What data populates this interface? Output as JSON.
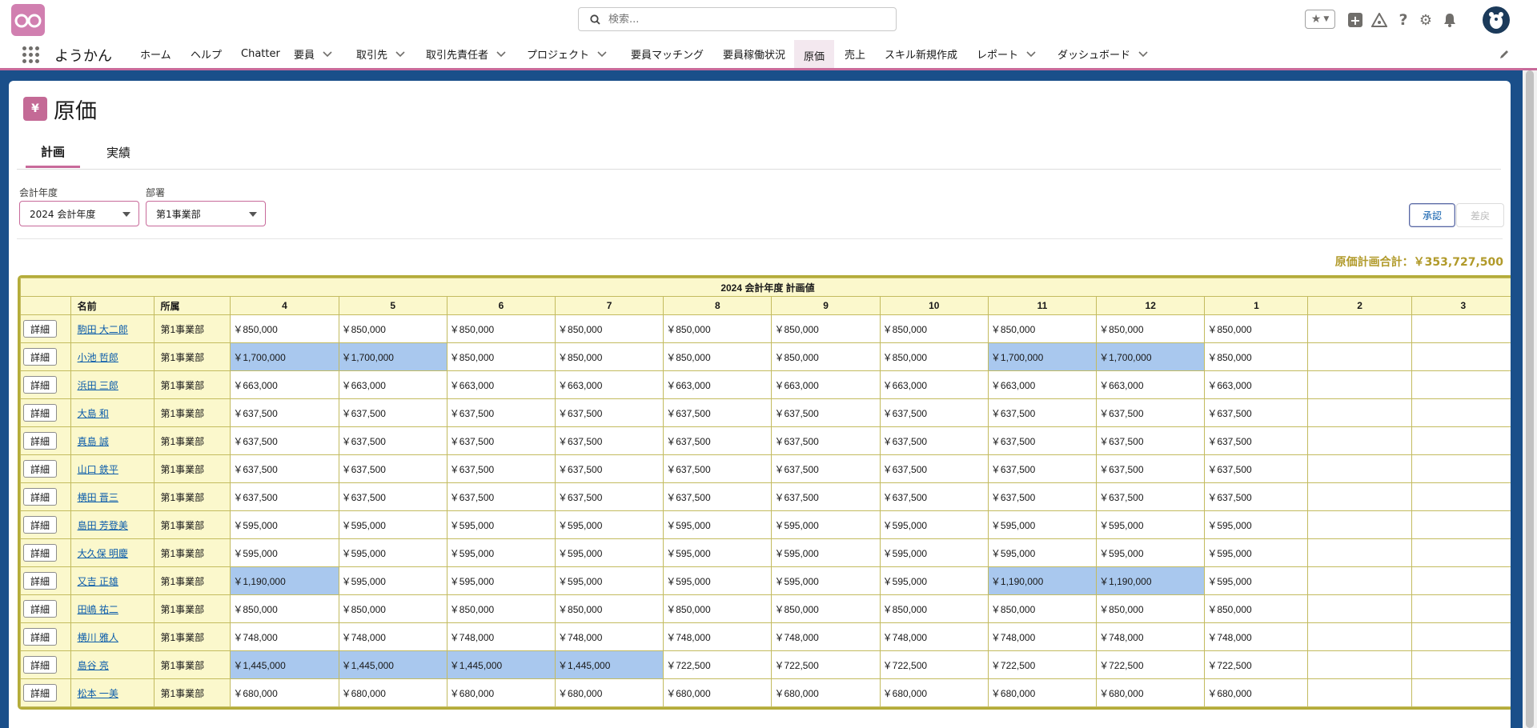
{
  "header": {
    "search_placeholder": "検索..."
  },
  "nav": {
    "app_name": "ようかん",
    "items": [
      {
        "label": "ホーム",
        "chevron": false
      },
      {
        "label": "ヘルプ",
        "chevron": false
      },
      {
        "label": "Chatter",
        "chevron": false
      },
      {
        "label": "要員",
        "chevron": true
      },
      {
        "label": "取引先",
        "chevron": true
      },
      {
        "label": "取引先責任者",
        "chevron": true
      },
      {
        "label": "プロジェクト",
        "chevron": true
      },
      {
        "label": "要員マッチング",
        "chevron": false
      },
      {
        "label": "要員稼働状況",
        "chevron": false
      },
      {
        "label": "原価",
        "chevron": false,
        "active": true
      },
      {
        "label": "売上",
        "chevron": false
      },
      {
        "label": "スキル新規作成",
        "chevron": false
      },
      {
        "label": "レポート",
        "chevron": true
      },
      {
        "label": "ダッシュボード",
        "chevron": true
      }
    ]
  },
  "page": {
    "title": "原価",
    "icon_glyph": "¥",
    "tabs": [
      {
        "label": "計画",
        "active": true
      },
      {
        "label": "実績",
        "active": false
      }
    ],
    "filters": {
      "year_label": "会計年度",
      "year_value": "2024 会計年度",
      "dept_label": "部署",
      "dept_value": "第1事業部"
    },
    "buttons": {
      "approve": "承認",
      "revert": "差戻"
    },
    "total": "原価計画合計：￥353,727,500"
  },
  "table": {
    "caption": "2024 会計年度 計画値",
    "headers": {
      "name": "名前",
      "dept": "所属"
    },
    "months": [
      "4",
      "5",
      "6",
      "7",
      "8",
      "9",
      "10",
      "11",
      "12",
      "1",
      "2",
      "3"
    ],
    "detail_label": "詳細",
    "rows": [
      {
        "name": "駒田 大二郎",
        "dept": "第1事業部",
        "values": [
          "￥850,000",
          "￥850,000",
          "￥850,000",
          "￥850,000",
          "￥850,000",
          "￥850,000",
          "￥850,000",
          "￥850,000",
          "￥850,000",
          "￥850,000",
          "",
          ""
        ],
        "highlight": []
      },
      {
        "name": "小池 哲郎",
        "dept": "第1事業部",
        "values": [
          "￥1,700,000",
          "￥1,700,000",
          "￥850,000",
          "￥850,000",
          "￥850,000",
          "￥850,000",
          "￥850,000",
          "￥1,700,000",
          "￥1,700,000",
          "￥850,000",
          "",
          ""
        ],
        "highlight": [
          0,
          1,
          7,
          8
        ]
      },
      {
        "name": "浜田 三郎",
        "dept": "第1事業部",
        "values": [
          "￥663,000",
          "￥663,000",
          "￥663,000",
          "￥663,000",
          "￥663,000",
          "￥663,000",
          "￥663,000",
          "￥663,000",
          "￥663,000",
          "￥663,000",
          "",
          ""
        ],
        "highlight": []
      },
      {
        "name": "大島 和",
        "dept": "第1事業部",
        "values": [
          "￥637,500",
          "￥637,500",
          "￥637,500",
          "￥637,500",
          "￥637,500",
          "￥637,500",
          "￥637,500",
          "￥637,500",
          "￥637,500",
          "￥637,500",
          "",
          ""
        ],
        "highlight": []
      },
      {
        "name": "真島 誠",
        "dept": "第1事業部",
        "values": [
          "￥637,500",
          "￥637,500",
          "￥637,500",
          "￥637,500",
          "￥637,500",
          "￥637,500",
          "￥637,500",
          "￥637,500",
          "￥637,500",
          "￥637,500",
          "",
          ""
        ],
        "highlight": []
      },
      {
        "name": "山口 鉄平",
        "dept": "第1事業部",
        "values": [
          "￥637,500",
          "￥637,500",
          "￥637,500",
          "￥637,500",
          "￥637,500",
          "￥637,500",
          "￥637,500",
          "￥637,500",
          "￥637,500",
          "￥637,500",
          "",
          ""
        ],
        "highlight": []
      },
      {
        "name": "横田 晋三",
        "dept": "第1事業部",
        "values": [
          "￥637,500",
          "￥637,500",
          "￥637,500",
          "￥637,500",
          "￥637,500",
          "￥637,500",
          "￥637,500",
          "￥637,500",
          "￥637,500",
          "￥637,500",
          "",
          ""
        ],
        "highlight": []
      },
      {
        "name": "島田 芳登美",
        "dept": "第1事業部",
        "values": [
          "￥595,000",
          "￥595,000",
          "￥595,000",
          "￥595,000",
          "￥595,000",
          "￥595,000",
          "￥595,000",
          "￥595,000",
          "￥595,000",
          "￥595,000",
          "",
          ""
        ],
        "highlight": []
      },
      {
        "name": "大久保 明慶",
        "dept": "第1事業部",
        "values": [
          "￥595,000",
          "￥595,000",
          "￥595,000",
          "￥595,000",
          "￥595,000",
          "￥595,000",
          "￥595,000",
          "￥595,000",
          "￥595,000",
          "￥595,000",
          "",
          ""
        ],
        "highlight": []
      },
      {
        "name": "又吉 正雄",
        "dept": "第1事業部",
        "values": [
          "￥1,190,000",
          "￥595,000",
          "￥595,000",
          "￥595,000",
          "￥595,000",
          "￥595,000",
          "￥595,000",
          "￥1,190,000",
          "￥1,190,000",
          "￥595,000",
          "",
          ""
        ],
        "highlight": [
          0,
          7,
          8
        ]
      },
      {
        "name": "田嶋 祐二",
        "dept": "第1事業部",
        "values": [
          "￥850,000",
          "￥850,000",
          "￥850,000",
          "￥850,000",
          "￥850,000",
          "￥850,000",
          "￥850,000",
          "￥850,000",
          "￥850,000",
          "￥850,000",
          "",
          ""
        ],
        "highlight": []
      },
      {
        "name": "横川 雅人",
        "dept": "第1事業部",
        "values": [
          "￥748,000",
          "￥748,000",
          "￥748,000",
          "￥748,000",
          "￥748,000",
          "￥748,000",
          "￥748,000",
          "￥748,000",
          "￥748,000",
          "￥748,000",
          "",
          ""
        ],
        "highlight": []
      },
      {
        "name": "島谷 亮",
        "dept": "第1事業部",
        "values": [
          "￥1,445,000",
          "￥1,445,000",
          "￥1,445,000",
          "￥1,445,000",
          "￥722,500",
          "￥722,500",
          "￥722,500",
          "￥722,500",
          "￥722,500",
          "￥722,500",
          "",
          ""
        ],
        "highlight": [
          0,
          1,
          2,
          3
        ]
      },
      {
        "name": "松本 一美",
        "dept": "第1事業部",
        "values": [
          "￥680,000",
          "￥680,000",
          "￥680,000",
          "￥680,000",
          "￥680,000",
          "￥680,000",
          "￥680,000",
          "￥680,000",
          "￥680,000",
          "￥680,000",
          "",
          ""
        ],
        "highlight": []
      }
    ]
  },
  "colors": {
    "accent": "#c86a9a",
    "table_border": "#b4ac3a",
    "header_bg": "#fbf8cc",
    "highlight": "#a9c8ee",
    "total_text": "#b19a2a"
  }
}
